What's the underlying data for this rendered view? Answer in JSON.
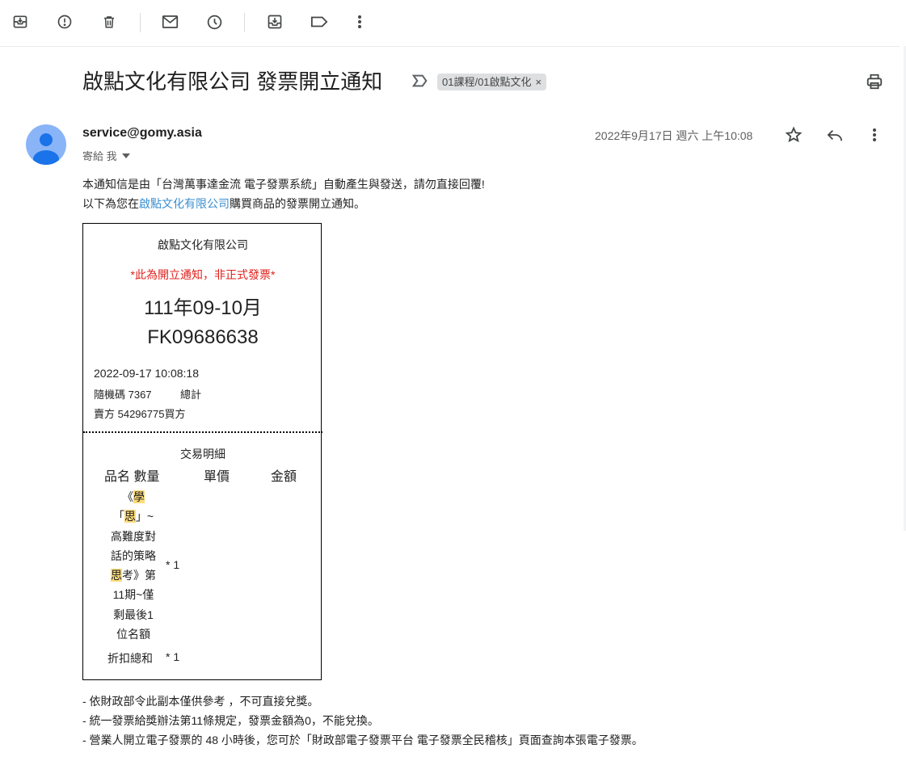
{
  "toolbar": {
    "icons": [
      "archive-icon",
      "report-spam-icon",
      "delete-icon",
      "mark-unread-icon",
      "snooze-icon",
      "move-to-icon",
      "label-icon",
      "more-vert-icon"
    ]
  },
  "email": {
    "subject": "啟點文化有限公司 發票開立通知",
    "label": "01課程/01啟點文化",
    "label_close": "×",
    "sender": "service@gomy.asia",
    "recipient": "寄給 我",
    "date": "2022年9月17日 週六 上午10:08",
    "body_line1": "本通知信是由「台灣萬事達金流 電子發票系統」自動產生與發送，請勿直接回覆!",
    "body_line2_prefix": "以下為您在",
    "body_line2_link": "啟點文化有限公司",
    "body_line2_suffix": "購買商品的發票開立通知。"
  },
  "invoice": {
    "company": "啟點文化有限公司",
    "notice": "*此為開立通知，非正式發票*",
    "period": "111年09-10月",
    "number": "FK09686638",
    "datetime": "2022-09-17 10:08:18",
    "random_code_label": "隨機碼 7367",
    "total_label": "總計",
    "seller_label": "賣方 54296775買方",
    "details_title": "交易明細",
    "col_name_qty": "品名 數量",
    "col_unit_price": "單價",
    "col_amount": "金額",
    "item1_lines": [
      "《學",
      "「思」~",
      "高難度對",
      "話的策略",
      "思考》第",
      "11期~僅",
      "剩最後1",
      "位名額"
    ],
    "item1_qty": "* 1",
    "item2_name": "折扣總和",
    "item2_qty": "* 1"
  },
  "footer": {
    "line1": "- 依財政部令此副本僅供參考 ，不可直接兌獎。",
    "line2": "- 統一發票給獎辦法第11條規定，發票金額為0，不能兌換。",
    "line3": "- 營業人開立電子發票的 48 小時後，您可於「財政部電子發票平台 電子發票全民稽核」頁面查詢本張電子發票。"
  }
}
